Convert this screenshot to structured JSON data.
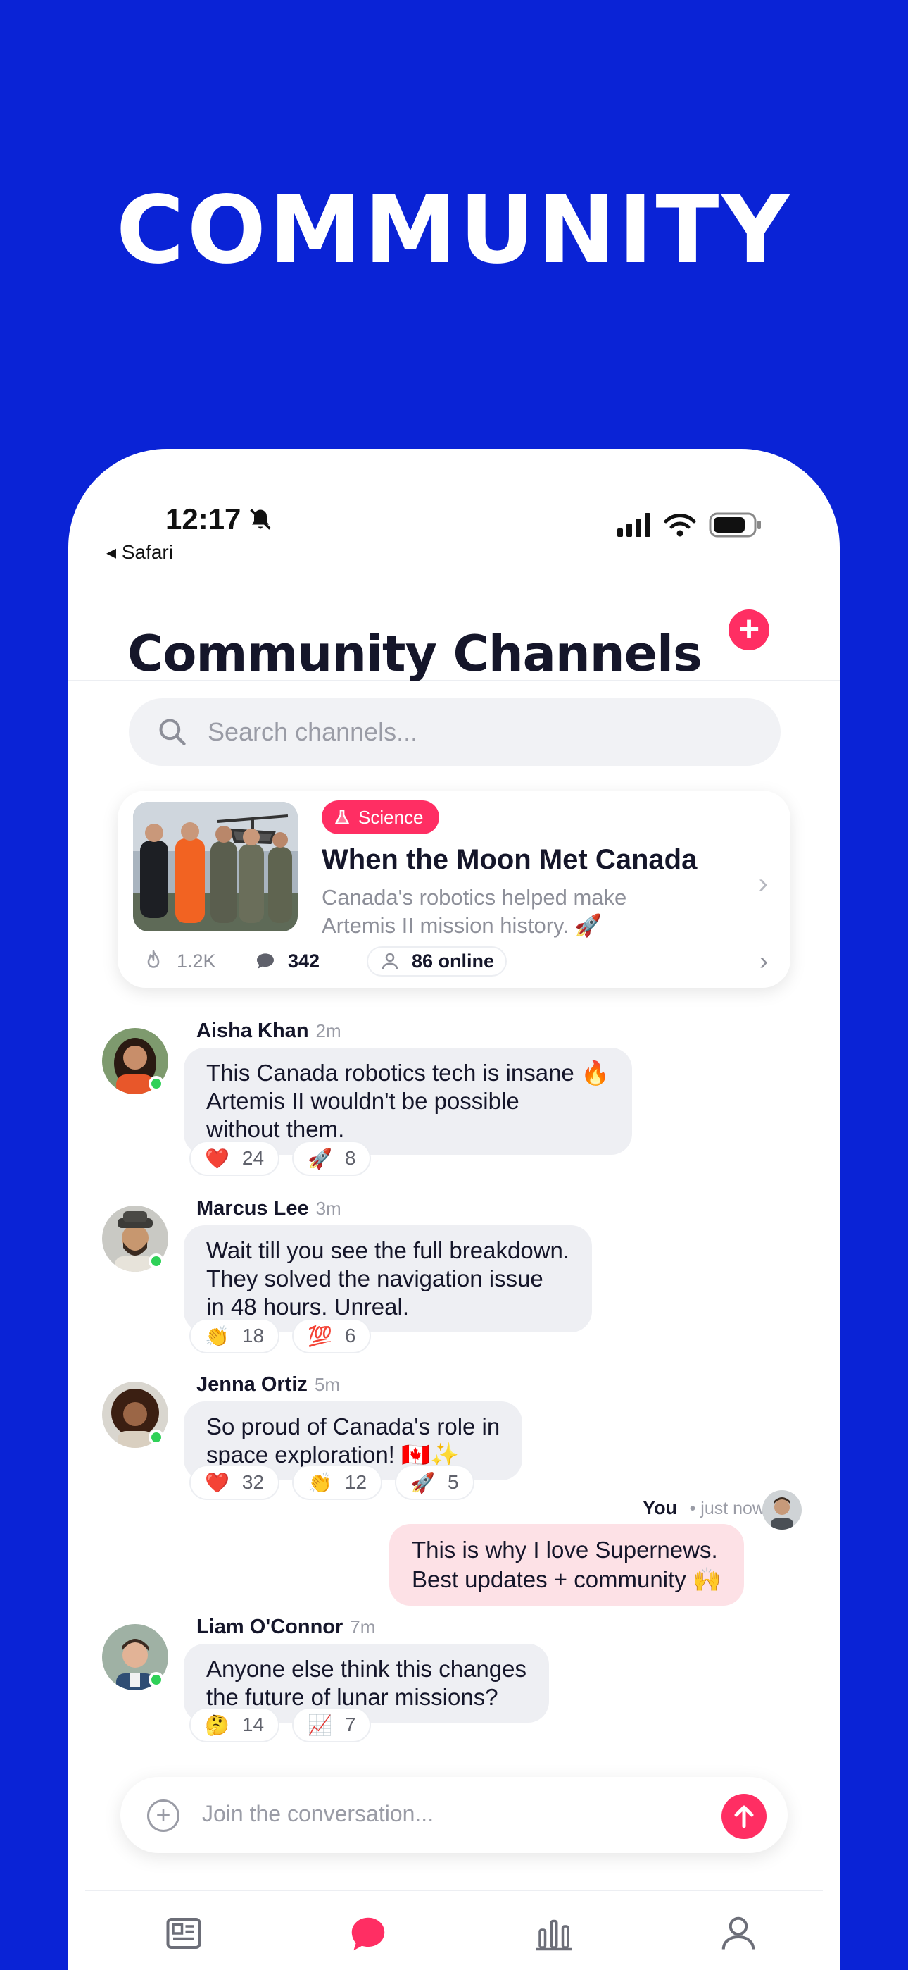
{
  "headline": "COMMUNITY",
  "status": {
    "time": "12:17",
    "back_app": "◂ Safari"
  },
  "page_title": "Community Channels",
  "search": {
    "placeholder": "Search channels..."
  },
  "featured": {
    "tag": "Science",
    "title": "When the Moon Met Canada",
    "subtitle": "Canada's robotics helped make Artemis II mission history. 🚀",
    "likes": "1.2K",
    "comments": "342",
    "online": "86 online"
  },
  "messages": [
    {
      "name": "Aisha Khan",
      "time": "2m",
      "text": "This Canada robotics tech is insane 🔥\nArtemis II wouldn't be possible\nwithout them.",
      "reactions": [
        {
          "emoji": "❤️",
          "count": "24"
        },
        {
          "emoji": "🚀",
          "count": "8"
        }
      ]
    },
    {
      "name": "Marcus Lee",
      "time": "3m",
      "text": "Wait till you see the full breakdown.\nThey solved the navigation issue\nin 48 hours. Unreal.",
      "reactions": [
        {
          "emoji": "👏",
          "count": "18"
        },
        {
          "emoji": "💯",
          "count": "6"
        }
      ]
    },
    {
      "name": "Jenna Ortiz",
      "time": "5m",
      "text": "So proud of Canada's role in\nspace exploration! 🇨🇦✨",
      "reactions": [
        {
          "emoji": "❤️",
          "count": "32"
        },
        {
          "emoji": "👏",
          "count": "12"
        },
        {
          "emoji": "🚀",
          "count": "5"
        }
      ]
    },
    {
      "name": "Liam O'Connor",
      "time": "7m",
      "text": "Anyone else think this changes\nthe future of lunar missions?",
      "reactions": [
        {
          "emoji": "🤔",
          "count": "14"
        },
        {
          "emoji": "📈",
          "count": "7"
        }
      ]
    }
  ],
  "my_message": {
    "name": "You",
    "time": "• just now",
    "text": "This is why I love Supernews.\nBest updates + community 🙌"
  },
  "composer": {
    "placeholder": "Join the conversation..."
  },
  "colors": {
    "brand_blue": "#0a23d6",
    "accent": "#ff2e63"
  }
}
